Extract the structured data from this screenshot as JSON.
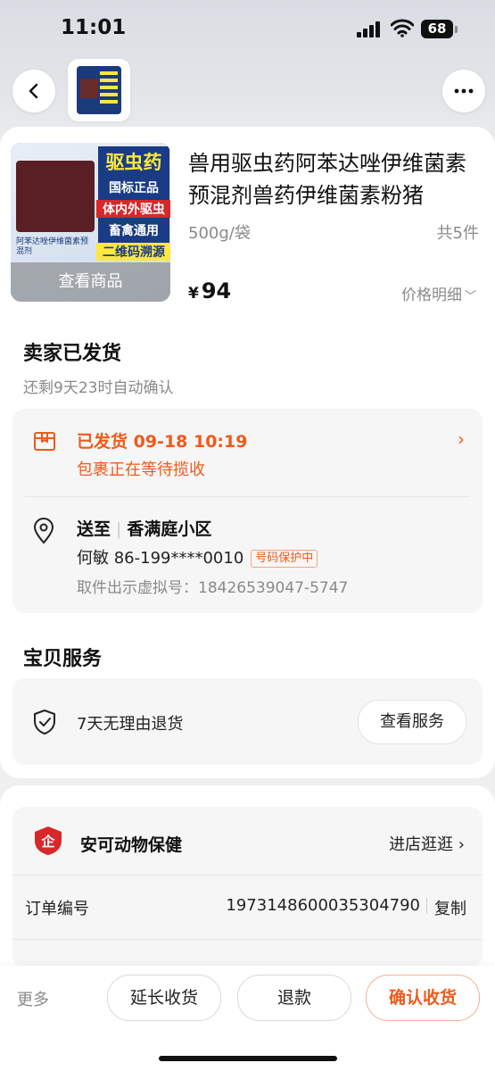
{
  "status_bar": {
    "time": "11:01",
    "battery": "68"
  },
  "header": {
    "back": "back",
    "more": "more"
  },
  "product": {
    "title": "兽用驱虫药阿苯达唑伊维菌素预混剂兽药伊维菌素粉猪",
    "spec": "500g/袋",
    "quantity": "共5件",
    "price_symbol": "¥",
    "price": "94",
    "price_detail": "价格明细",
    "view_product": "查看商品",
    "package_text": {
      "title": "驱虫药",
      "line1": "国标正品",
      "line2": "体内外驱虫",
      "line3": "畜禽通用",
      "line4": "二维码溯源",
      "sub": "阿苯达唑伊维菌素预混剂"
    }
  },
  "order_status": {
    "title": "卖家已发货",
    "subtitle": "还剩9天23时自动确认"
  },
  "shipping": {
    "status": "已发货 09-18 10:19",
    "detail": "包裹正在等待揽收"
  },
  "address": {
    "prefix": "送至",
    "community": "香满庭小区",
    "recipient": "何敏 86-199****0010",
    "privacy_badge": "号码保护中",
    "pickup": "取件出示虚拟号：18426539047-5747"
  },
  "service": {
    "title": "宝贝服务",
    "item": "7天无理由退货",
    "button": "查看服务"
  },
  "shop": {
    "name": "安可动物保健",
    "link": "进店逛逛"
  },
  "order": {
    "label": "订单编号",
    "number": "1973148600035304790",
    "copy": "复制"
  },
  "bottom_bar": {
    "more": "更多",
    "extend": "延长收货",
    "refund": "退款",
    "confirm": "确认收货"
  },
  "colors": {
    "accent": "#f05a1a",
    "shop_badge": "#d8272a"
  }
}
